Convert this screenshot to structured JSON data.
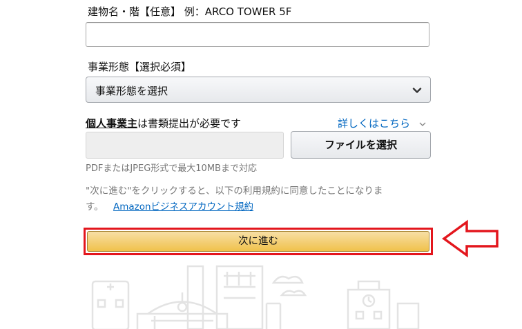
{
  "building": {
    "label": "建物名・階【任意】 例：ARCO TOWER 5F",
    "value": ""
  },
  "business_type": {
    "label": "事業形態【選択必須】",
    "selected": "事業形態を選択"
  },
  "documents": {
    "label_bold": "個人事業主",
    "label_rest": "は書類提出が必要です",
    "details_link": "詳しくはこちら",
    "file_button": "ファイルを選択",
    "file_hint": "PDFまたはJPEG形式で最大10MBまで対応"
  },
  "agreement": {
    "text_line1": "\"次に進む\"をクリックすると、以下の利用規約に同意したことになりま",
    "text_line2": "す。",
    "terms_link": "Amazonビジネスアカウント規約"
  },
  "next_button": "次に進む",
  "colors": {
    "link": "#0066c0",
    "highlight": "#e3161d",
    "button_top": "#f7dfa5",
    "button_bottom": "#f0c14b"
  }
}
